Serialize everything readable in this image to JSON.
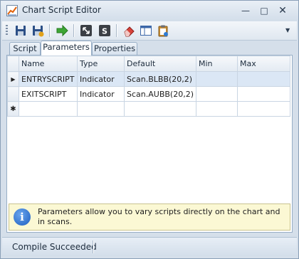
{
  "window": {
    "title": "Chart Script Editor"
  },
  "tabs": [
    {
      "label": "Script"
    },
    {
      "label": "Parameters"
    },
    {
      "label": "Properties"
    }
  ],
  "grid": {
    "columns": [
      "Name",
      "Type",
      "Default",
      "Min",
      "Max"
    ],
    "rows": [
      {
        "indicator": "▶",
        "name": "ENTRYSCRIPT",
        "type": "Indicator",
        "default": "Scan.BLBB(20,2)",
        "min": "",
        "max": ""
      },
      {
        "indicator": "",
        "name": "EXITSCRIPT",
        "type": "Indicator",
        "default": "Scan.AUBB(20,2)",
        "min": "",
        "max": ""
      }
    ],
    "new_row_marker": "✱"
  },
  "info": {
    "text": "Parameters allow you to vary scripts directly on the chart and in scans."
  },
  "status": {
    "text": "Compile Succeeded"
  },
  "colors": {
    "accent": "#dbe7f5",
    "chrome": "#d5dfea",
    "info_bg": "#fbf8d4"
  }
}
